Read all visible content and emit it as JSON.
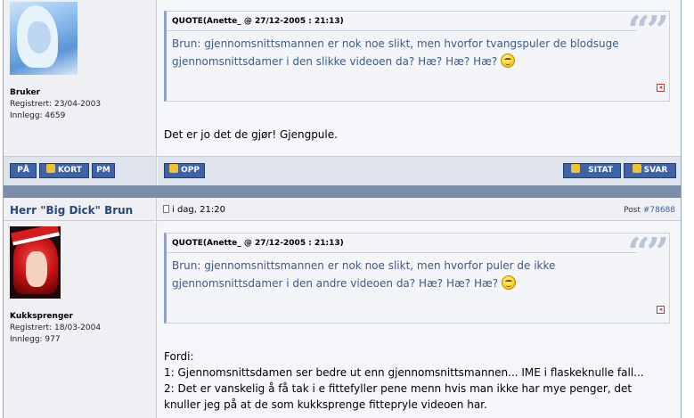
{
  "post1": {
    "user": {
      "rank": "Bruker",
      "registered": "Registrert: 23/04-2003",
      "posts": "Innlegg: 4659"
    },
    "quote": {
      "header": "QUOTE(Anette_ @ 27/12-2005 : 21:13)",
      "text": "Brun: gjennomsnittsmannen er nok noe slikt, men hvorfor tvangspuler de blodsuge gjennomsnittsdamer i den slikke videoen da? Hæ? Hæ? Hæ?"
    },
    "message": "Det er jo det de gjør! Gjengpule."
  },
  "actions": {
    "pa": "PÅ",
    "kort": "KORT",
    "pm": "PM",
    "opp": "OPP",
    "sitat": "SITAT",
    "svar": "SVAR"
  },
  "post2": {
    "author": "Herr \"Big Dick\" Brun",
    "date": "i dag, 21:20",
    "post_label": "Post",
    "post_number": "#78688",
    "user": {
      "rank": "Kukksprenger",
      "registered": "Registrert: 18/03-2004",
      "posts": "Innlegg: 977"
    },
    "quote": {
      "header": "QUOTE(Anette_ @ 27/12-2005 : 21:13)",
      "text": "Brun: gjennomsnittsmannen er nok noe slikt, men hvorfor puler de ikke gjennomsnittsdamer i den andre videoen da? Hæ? Hæ? Hæ?"
    },
    "message_lines": [
      "Fordi:",
      "1: Gjennomsnittsdamen ser bedre ut enn gjennomsnittsmannen... IME i flaskeknulle fall...",
      "2: Det er vanskelig å få tak i e fittefyller pene menn hvis man ikke har mye penger, det",
      "knuller jeg på at de som kukksprenge fittepryle videoen har."
    ]
  },
  "colors": {
    "button_bg": "#3f63a8",
    "author": "#27487f",
    "quote_text": "#3e5b87",
    "separator": "#7b8ea9"
  }
}
